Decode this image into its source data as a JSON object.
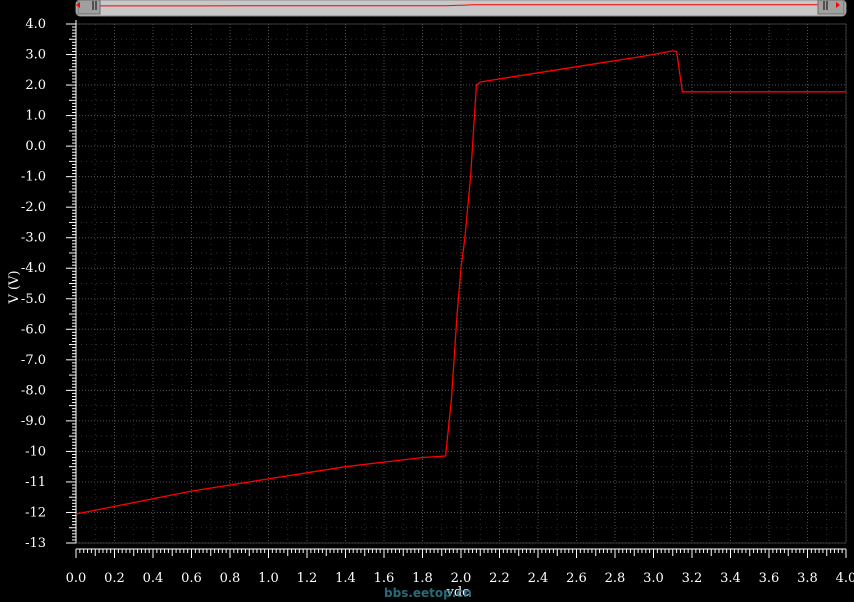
{
  "watermark": "bbs.eetop.cn",
  "colors": {
    "background": "#000000",
    "trace": "#ff0000",
    "axis": "#ffffff",
    "grid": "#5a5a5a",
    "scrollbar": "#c8c8c8",
    "watermark": "#2f7f8f"
  },
  "chart_data": {
    "type": "line",
    "title": "",
    "xlabel": "vdc",
    "ylabel": "V (V)",
    "xlim": [
      0.0,
      4.0
    ],
    "ylim": [
      -13.0,
      4.0
    ],
    "grid": true,
    "x_ticks": [
      "0.0",
      "0.2",
      "0.4",
      "0.6",
      "0.8",
      "1.0",
      "1.2",
      "1.4",
      "1.6",
      "1.8",
      "2.0",
      "2.2",
      "2.4",
      "2.6",
      "2.8",
      "3.0",
      "3.2",
      "3.4",
      "3.6",
      "3.8",
      "4.0"
    ],
    "y_ticks": [
      "4.0",
      "3.0",
      "2.0",
      "1.0",
      "0.0",
      "-1.0",
      "-2.0",
      "-3.0",
      "-4.0",
      "-5.0",
      "-6.0",
      "-7.0",
      "-8.0",
      "-9.0",
      "-10",
      "-11",
      "-12",
      "-13"
    ],
    "series": [
      {
        "color": "#ff0000",
        "x": [
          0.0,
          0.2,
          0.4,
          0.6,
          0.8,
          1.0,
          1.2,
          1.4,
          1.6,
          1.8,
          1.92,
          1.95,
          1.98,
          2.0,
          2.02,
          2.05,
          2.08,
          2.1,
          2.4,
          2.7,
          2.95,
          3.1,
          3.12,
          3.15,
          3.5,
          4.0
        ],
        "y": [
          -12.05,
          -11.8,
          -11.55,
          -11.3,
          -11.1,
          -10.9,
          -10.7,
          -10.5,
          -10.35,
          -10.2,
          -10.15,
          -8.3,
          -5.5,
          -4.0,
          -3.0,
          -1.0,
          2.0,
          2.1,
          2.4,
          2.7,
          2.95,
          3.12,
          3.1,
          1.78,
          1.78,
          1.78
        ]
      }
    ]
  }
}
